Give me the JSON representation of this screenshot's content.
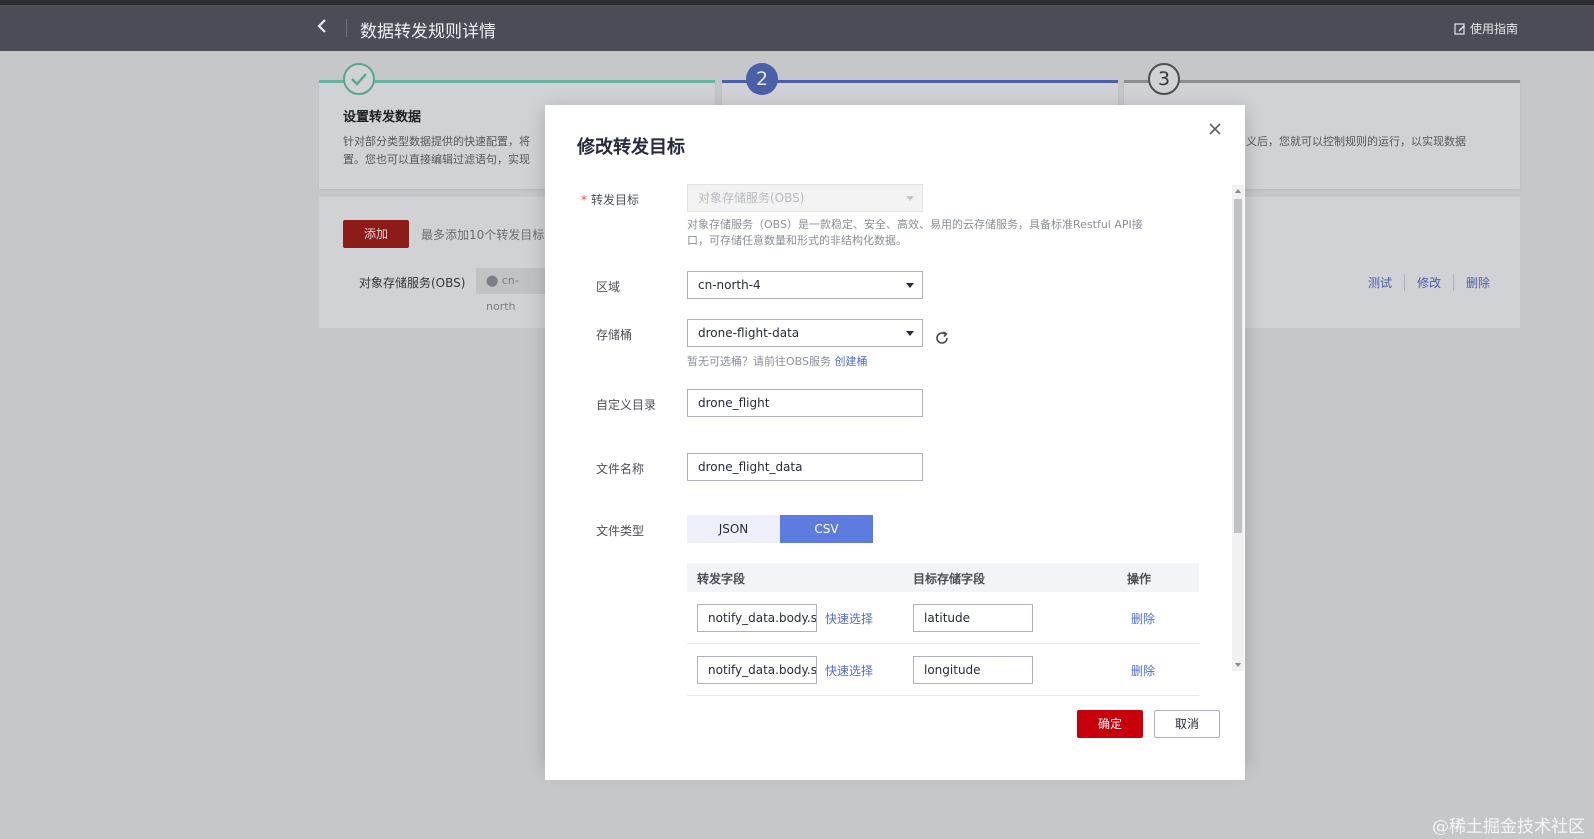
{
  "header": {
    "title": "数据转发规则详情",
    "guide_label": "使用指南"
  },
  "steps": [
    {
      "number": "2"
    },
    {
      "number": "3"
    }
  ],
  "step1": {
    "title": "设置转发数据",
    "desc_line1": "针对部分类型数据提供的快速配置，将",
    "desc_line2": "置。您也可以直接编辑过滤语句，实现"
  },
  "step3": {
    "desc": "义后，您就可以控制规则的运行，以实现数据"
  },
  "target_list": {
    "add_label": "添加",
    "add_hint": "最多添加10个转发目标",
    "row_label": "对象存储服务(OBS)",
    "region": "cn-north",
    "actions": [
      "测试",
      "修改",
      "删除"
    ]
  },
  "modal": {
    "title": "修改转发目标",
    "target": {
      "required_mark": "*",
      "label": "转发目标",
      "value": "对象存储服务(OBS)",
      "help_line1": "对象存储服务（OBS）是一款稳定、安全、高效、易用的云存储服务，具备标准Restful API接",
      "help_line2": "口，可存储任意数量和形式的非结构化数据。"
    },
    "region": {
      "label": "区域",
      "value": "cn-north-4"
    },
    "bucket": {
      "label": "存储桶",
      "value": "drone-flight-data",
      "hint": "暂无可选桶？请前往OBS服务",
      "hint_link": "创建桶"
    },
    "directory": {
      "label": "自定义目录",
      "value": "drone_flight"
    },
    "filename": {
      "label": "文件名称",
      "value": "drone_flight_data"
    },
    "filetype": {
      "label": "文件类型",
      "options": [
        "JSON",
        "CSV"
      ],
      "selected": "CSV"
    },
    "mapping": {
      "headers": [
        "转发字段",
        "目标存储字段",
        "操作"
      ],
      "rows": [
        {
          "field": "notify_data.body.se",
          "quick_select": "快速选择",
          "target": "latitude",
          "action": "删除"
        },
        {
          "field": "notify_data.body.se",
          "quick_select": "快速选择",
          "target": "longitude",
          "action": "删除"
        }
      ]
    },
    "ok_label": "确定",
    "cancel_label": "取消"
  },
  "watermark": "@稀土掘金技术社区",
  "colors": {
    "primary_red": "#c7000b",
    "accent_blue": "#5e7ce0",
    "link_blue": "#526ecc",
    "step_done_green": "#5aa592"
  }
}
